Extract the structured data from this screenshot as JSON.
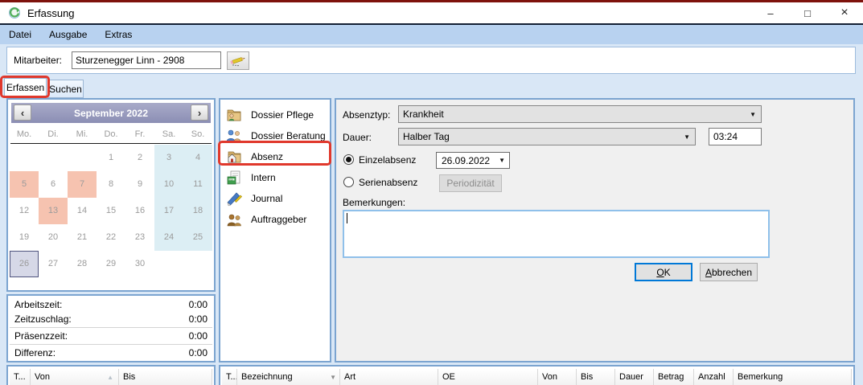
{
  "window": {
    "title": "Erfassung",
    "controls": {
      "minimize": "–",
      "maximize": "□",
      "close": "×"
    }
  },
  "menu": {
    "items": [
      "Datei",
      "Ausgabe",
      "Extras"
    ]
  },
  "employee": {
    "label": "Mitarbeiter:",
    "value": "Sturzenegger Linn - 2908"
  },
  "tabs": {
    "erfassen": "Erfassen",
    "suchen": "Suchen",
    "active": "Erfassen"
  },
  "calendar": {
    "title": "September 2022",
    "prev_icon": "‹",
    "next_icon": "›",
    "day_headers": [
      "Mo.",
      "Di.",
      "Mi.",
      "Do.",
      "Fr.",
      "Sa.",
      "So."
    ],
    "weeks": [
      [
        "",
        "",
        "",
        "1",
        "2",
        "3",
        "4"
      ],
      [
        "5",
        "6",
        "7",
        "8",
        "9",
        "10",
        "11"
      ],
      [
        "12",
        "13",
        "14",
        "15",
        "16",
        "17",
        "18"
      ],
      [
        "19",
        "20",
        "21",
        "22",
        "23",
        "24",
        "25"
      ],
      [
        "26",
        "27",
        "28",
        "29",
        "30",
        "",
        ""
      ]
    ],
    "highlighted_days": [
      "5",
      "7",
      "13"
    ],
    "selected_day": "26",
    "weekend_days": [
      "3",
      "4",
      "10",
      "11",
      "17",
      "18",
      "24",
      "25"
    ]
  },
  "summary": {
    "rows": [
      {
        "label": "Arbeitszeit:",
        "value": "0:00"
      },
      {
        "label": "Zeitzuschlag:",
        "value": "0:00"
      },
      {
        "label": "Präsenzzeit:",
        "value": "0:00"
      },
      {
        "label": "Differenz:",
        "value": "0:00"
      }
    ]
  },
  "sidebar": {
    "items": [
      {
        "label": "Dossier Pflege",
        "icon": "folder-person-icon"
      },
      {
        "label": "Dossier Beratung",
        "icon": "people-consult-icon"
      },
      {
        "label": "Absenz",
        "icon": "folder-home-icon",
        "highlighted": true
      },
      {
        "label": "Intern",
        "icon": "spreadsheet-icon"
      },
      {
        "label": "Journal",
        "icon": "tools-icon"
      },
      {
        "label": "Auftraggeber",
        "icon": "people-client-icon"
      }
    ]
  },
  "form": {
    "absenztyp": {
      "label": "Absenztyp:",
      "value": "Krankheit"
    },
    "dauer": {
      "label": "Dauer:",
      "value": "Halber Tag",
      "time": "03:24"
    },
    "einzelabsenz": {
      "label": "Einzelabsenz",
      "selected": true,
      "date": "26.09.2022"
    },
    "serienabsenz": {
      "label": "Serienabsenz",
      "selected": false,
      "button": "Periodizität"
    },
    "bemerkungen": {
      "label": "Bemerkungen:",
      "value": ""
    },
    "buttons": {
      "ok": "OK",
      "cancel": "Abbrechen"
    }
  },
  "left_table": {
    "columns": [
      "T...",
      "Von",
      "Bis"
    ],
    "sort_icon": "▲"
  },
  "right_table": {
    "columns": [
      "T...",
      "Bezeichnung",
      "Art",
      "OE",
      "Von",
      "Bis",
      "Dauer",
      "Betrag",
      "Anzahl",
      "Bemerkung"
    ],
    "filter_icon": "▼"
  },
  "colors": {
    "annotation_red": "#e0382c",
    "menu_bar": "#b8d2f0",
    "panel_border": "#7ba4d0",
    "weekend_day": "#dceef4",
    "absence_day": "#f6c3b0"
  }
}
